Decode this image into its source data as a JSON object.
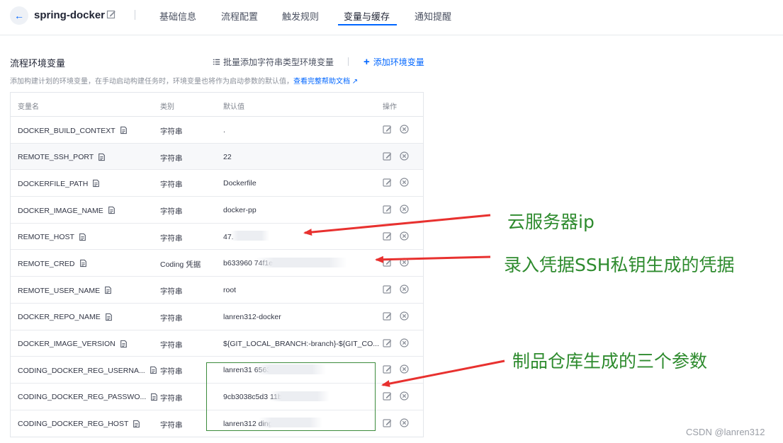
{
  "header": {
    "project_name": "spring-docker",
    "tabs": [
      {
        "label": "基础信息"
      },
      {
        "label": "流程配置"
      },
      {
        "label": "触发规则"
      },
      {
        "label": "变量与缓存"
      },
      {
        "label": "通知提醒"
      }
    ],
    "active_tab": "变量与缓存"
  },
  "section": {
    "title": "流程环境变量",
    "batch_add_label": "批量添加字符串类型环境变量",
    "add_label": "添加环境变量",
    "description": "添加构建计划的环境变量，在手动启动构建任务时，环境变量也将作为启动参数的默认值，",
    "help_link": "查看完整帮助文档"
  },
  "table": {
    "headers": {
      "name": "变量名",
      "type": "类别",
      "default": "默认值",
      "ops": "操作"
    },
    "rows": [
      {
        "name": "DOCKER_BUILD_CONTEXT",
        "type": "字符串",
        "value": "."
      },
      {
        "name": "REMOTE_SSH_PORT",
        "type": "字符串",
        "value": "22"
      },
      {
        "name": "DOCKERFILE_PATH",
        "type": "字符串",
        "value": "Dockerfile"
      },
      {
        "name": "DOCKER_IMAGE_NAME",
        "type": "字符串",
        "value": "docker-pp"
      },
      {
        "name": "REMOTE_HOST",
        "type": "字符串",
        "value": "47."
      },
      {
        "name": "REMOTE_CRED",
        "type": "Coding 凭据",
        "value": "b633960                                74f1ec52"
      },
      {
        "name": "REMOTE_USER_NAME",
        "type": "字符串",
        "value": "root"
      },
      {
        "name": "DOCKER_REPO_NAME",
        "type": "字符串",
        "value": "lanren312-docker"
      },
      {
        "name": "DOCKER_IMAGE_VERSION",
        "type": "字符串",
        "value": "${GIT_LOCAL_BRANCH:-branch}-${GIT_CO..."
      },
      {
        "name": "CODING_DOCKER_REG_USERNA...",
        "type": "字符串",
        "value": "lanren31                          656393"
      },
      {
        "name": "CODING_DOCKER_REG_PASSWO...",
        "type": "字符串",
        "value": "9cb3038c5d3                          11bd191ce9..."
      },
      {
        "name": "CODING_DOCKER_REG_HOST",
        "type": "字符串",
        "value": "lanren312                          ding.net"
      }
    ]
  },
  "annotations": {
    "cloud_ip": "云服务器ip",
    "ssh_cred": "录入凭据SSH私钥生成的凭据",
    "artifact_params": "制品仓库生成的三个参数"
  },
  "watermark": "CSDN @lanren312",
  "colors": {
    "accent": "#0066ff",
    "annotation": "#2e8b2e",
    "arrow": "#e8312f"
  }
}
